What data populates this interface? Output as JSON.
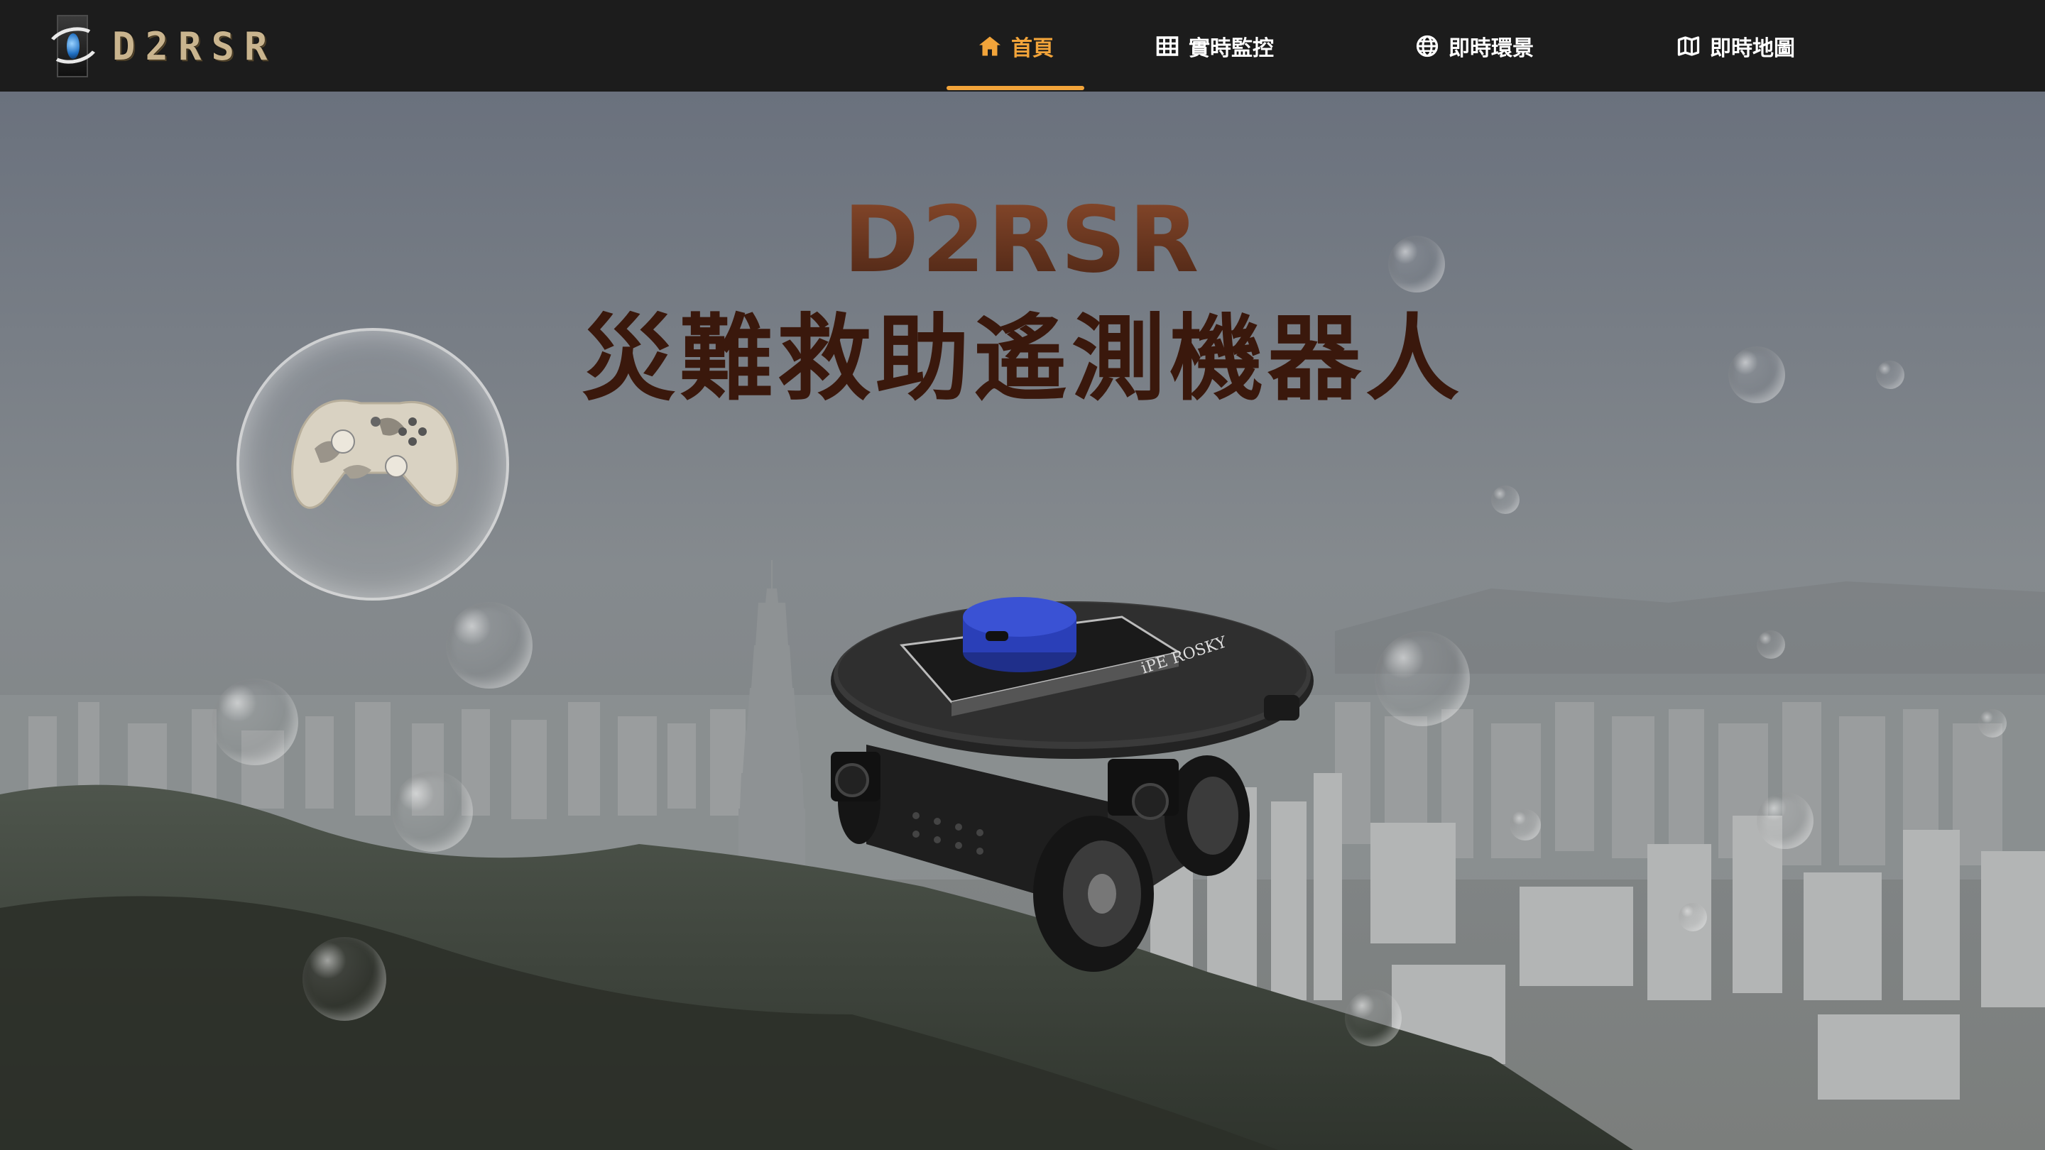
{
  "brand": {
    "logo_text": "D2RSR"
  },
  "nav": {
    "items": [
      {
        "label": "首頁",
        "icon": "home-icon",
        "active": true
      },
      {
        "label": "實時監控",
        "icon": "table-grid-icon",
        "active": false
      },
      {
        "label": "即時環景",
        "icon": "globe-icon",
        "active": false
      },
      {
        "label": "即時地圖",
        "icon": "map-icon",
        "active": false
      }
    ],
    "active_color": "#f2a43a",
    "text_color": "#ffffff"
  },
  "hero": {
    "title_latin": "D2RSR",
    "title_cjk": "災難救助遙測機器人",
    "robot_label": "iPE ROSKY",
    "images": [
      "game-controller-in-bubble",
      "rover-robot-with-lidar",
      "city-skyline-background"
    ]
  },
  "colors": {
    "navbar_bg": "#1c1c1c",
    "title_cjk": "#3a180c",
    "title_latin": "#6e3a24",
    "lidar_blue": "#2a3fb8"
  }
}
